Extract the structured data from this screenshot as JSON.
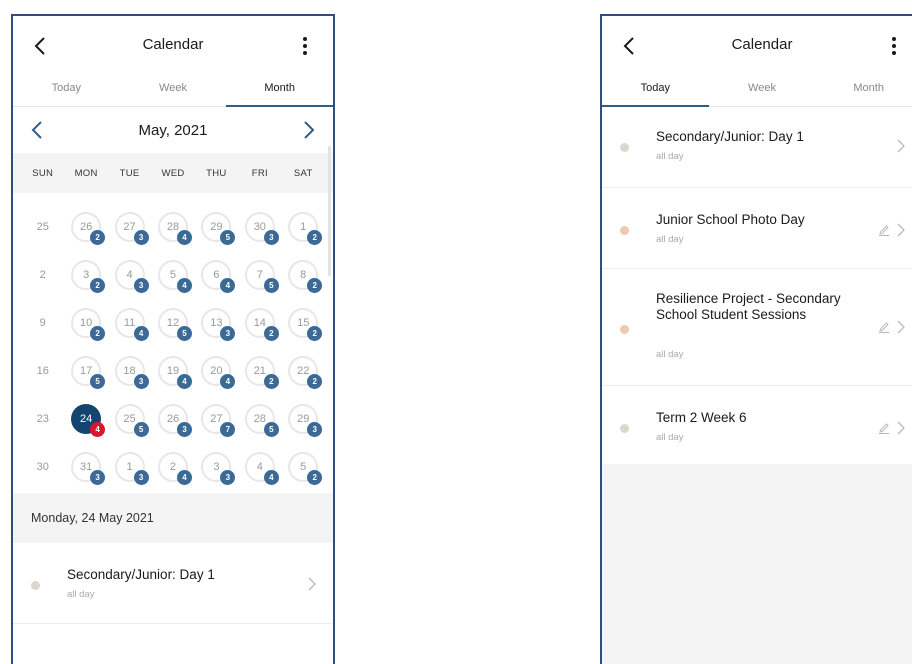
{
  "left": {
    "title": "Calendar",
    "tabs": [
      {
        "label": "Today",
        "active": false
      },
      {
        "label": "Week",
        "active": false
      },
      {
        "label": "Month",
        "active": true
      }
    ],
    "month_label": "May, 2021",
    "weekdays": [
      "SUN",
      "MON",
      "TUE",
      "WED",
      "THU",
      "FRI",
      "SAT"
    ],
    "weeks": [
      [
        {
          "d": "25",
          "c": null
        },
        {
          "d": "26",
          "c": "2"
        },
        {
          "d": "27",
          "c": "3"
        },
        {
          "d": "28",
          "c": "4"
        },
        {
          "d": "29",
          "c": "5"
        },
        {
          "d": "30",
          "c": "3"
        },
        {
          "d": "1",
          "c": "2"
        }
      ],
      [
        {
          "d": "2",
          "c": null
        },
        {
          "d": "3",
          "c": "2"
        },
        {
          "d": "4",
          "c": "3"
        },
        {
          "d": "5",
          "c": "4"
        },
        {
          "d": "6",
          "c": "4"
        },
        {
          "d": "7",
          "c": "5"
        },
        {
          "d": "8",
          "c": "2"
        }
      ],
      [
        {
          "d": "9",
          "c": null
        },
        {
          "d": "10",
          "c": "2"
        },
        {
          "d": "11",
          "c": "4"
        },
        {
          "d": "12",
          "c": "5"
        },
        {
          "d": "13",
          "c": "3"
        },
        {
          "d": "14",
          "c": "2"
        },
        {
          "d": "15",
          "c": "2"
        }
      ],
      [
        {
          "d": "16",
          "c": null
        },
        {
          "d": "17",
          "c": "5"
        },
        {
          "d": "18",
          "c": "3"
        },
        {
          "d": "19",
          "c": "4"
        },
        {
          "d": "20",
          "c": "4"
        },
        {
          "d": "21",
          "c": "2"
        },
        {
          "d": "22",
          "c": "2"
        }
      ],
      [
        {
          "d": "23",
          "c": null
        },
        {
          "d": "24",
          "c": "4",
          "selected": true
        },
        {
          "d": "25",
          "c": "5"
        },
        {
          "d": "26",
          "c": "3"
        },
        {
          "d": "27",
          "c": "7"
        },
        {
          "d": "28",
          "c": "5"
        },
        {
          "d": "29",
          "c": "3"
        }
      ],
      [
        {
          "d": "30",
          "c": null
        },
        {
          "d": "31",
          "c": "3"
        },
        {
          "d": "1",
          "c": "3"
        },
        {
          "d": "2",
          "c": "4"
        },
        {
          "d": "3",
          "c": "3"
        },
        {
          "d": "4",
          "c": "4"
        },
        {
          "d": "5",
          "c": "2"
        }
      ]
    ],
    "selected_date_label": "Monday, 24 May 2021",
    "events": [
      {
        "title": "Secondary/Junior: Day 1",
        "subtitle": "all day",
        "dot_color": "#dcd6cc"
      }
    ]
  },
  "right": {
    "title": "Calendar",
    "tabs": [
      {
        "label": "Today",
        "active": true
      },
      {
        "label": "Week",
        "active": false
      },
      {
        "label": "Month",
        "active": false
      }
    ],
    "events": [
      {
        "title": "Secondary/Junior: Day 1",
        "subtitle": "all day",
        "dot_color": "#dcd6cc",
        "editable": false
      },
      {
        "title": "Junior School Photo Day",
        "subtitle": "all day",
        "dot_color": "#f0c8ad",
        "editable": true
      },
      {
        "title": "Resilience Project - Secondary School Student Sessions",
        "subtitle": "all day",
        "dot_color": "#f0c8ad",
        "editable": true
      },
      {
        "title": "Term 2 Week 6",
        "subtitle": "all day",
        "dot_color": "#dcd6cc",
        "editable": true
      }
    ]
  },
  "colors": {
    "accent": "#2f5d8a",
    "badge": "#3c6a96",
    "badge_alert": "#d8182a",
    "selected_day": "#15456f"
  },
  "icons": {
    "back": "chevron-left-icon",
    "menu": "kebab-menu-icon",
    "prev_month": "chevron-left-icon",
    "next_month": "chevron-right-icon",
    "event_open": "chevron-right-icon",
    "edit": "pencil-icon"
  }
}
